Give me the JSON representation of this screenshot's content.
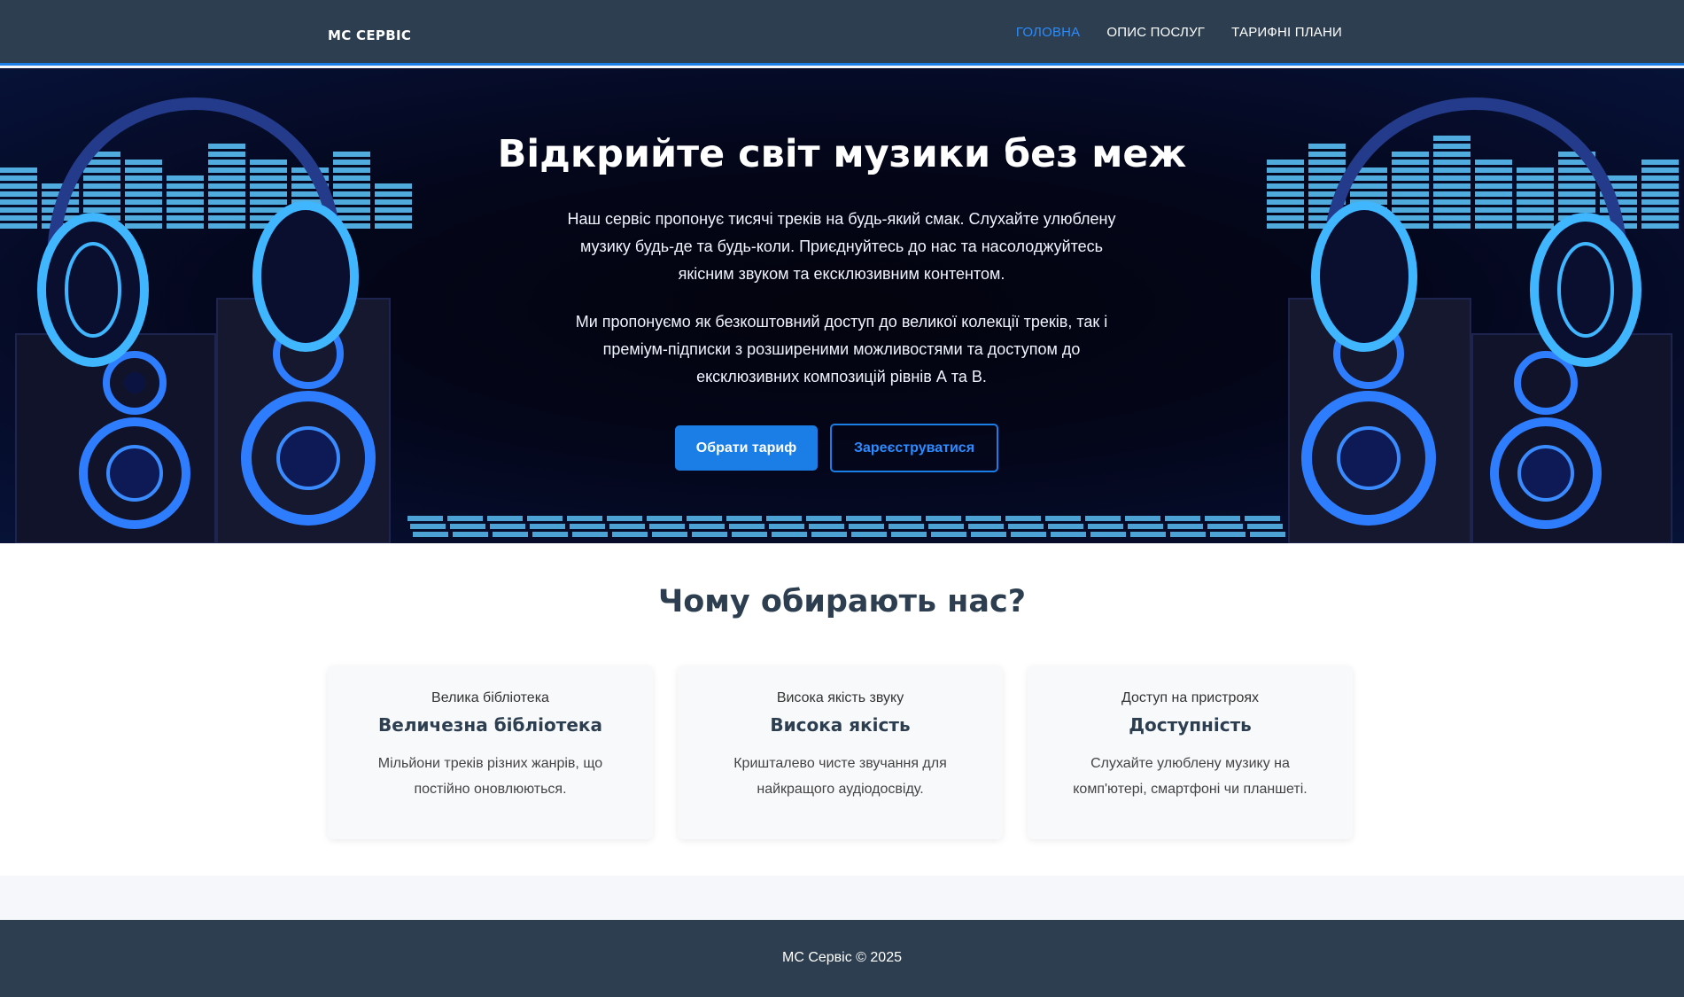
{
  "header": {
    "brand": "МС СЕРВІС",
    "nav": [
      {
        "label": "ГОЛОВНА",
        "active": true
      },
      {
        "label": "ОПИС ПОСЛУГ",
        "active": false
      },
      {
        "label": "ТАРИФНІ ПЛАНИ",
        "active": false
      }
    ]
  },
  "hero": {
    "title": "Відкрийте світ музики без меж",
    "paragraph1": "Наш сервіс пропонує тисячі треків на будь-який смак. Слухайте улюблену музику будь-де та будь-коли. Приєднуйтесь до нас та насолоджуйтесь якісним звуком та ексклюзивним контентом.",
    "paragraph2": "Ми пропонуємо як безкоштовний доступ до великої колекції треків, так і преміум-підписки з розширеними можливостями та доступом до ексклюзивних композицій рівнів А та В.",
    "primary_button": "Обрати тариф",
    "secondary_button": "Зареєструватися"
  },
  "features": {
    "heading": "Чому обирають нас?",
    "cards": [
      {
        "caption": "Велика бібліотека",
        "title": "Величезна бібліотека",
        "description": "Мільйони треків різних жанрів, що постійно оновлюються."
      },
      {
        "caption": "Висока якість звуку",
        "title": "Висока якість",
        "description": "Кришталево чисте звучання для найкращого аудіодосвіду."
      },
      {
        "caption": "Доступ на пристроях",
        "title": "Доступність",
        "description": "Слухайте улюблену музику на комп'ютері, смартфоні чи планшеті."
      }
    ]
  },
  "footer": {
    "text": "МС Сервіс © 2025"
  },
  "colors": {
    "header_bg": "#2c3e50",
    "accent": "#1a7ee6",
    "neon": "#3fa9ff"
  }
}
